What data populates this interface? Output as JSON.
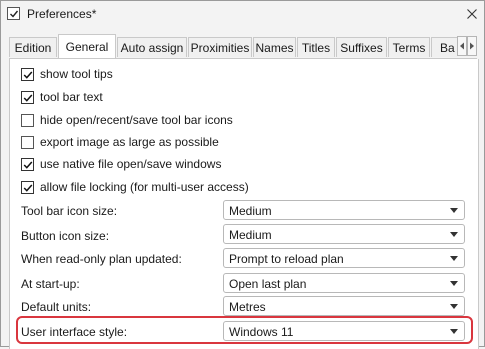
{
  "window": {
    "title": "Preferences*"
  },
  "tabs": [
    {
      "label": "Edition"
    },
    {
      "label": "General"
    },
    {
      "label": "Auto assign"
    },
    {
      "label": "Proximities"
    },
    {
      "label": "Names"
    },
    {
      "label": "Titles"
    },
    {
      "label": "Suffixes"
    },
    {
      "label": "Terms"
    },
    {
      "label": "Ba"
    }
  ],
  "active_tab": "General",
  "checkboxes": [
    {
      "label": "show tool tips",
      "checked": true
    },
    {
      "label": "tool bar text",
      "checked": true
    },
    {
      "label": "hide open/recent/save tool bar icons",
      "checked": false
    },
    {
      "label": "export image as large as possible",
      "checked": false
    },
    {
      "label": "use native file open/save windows",
      "checked": true
    },
    {
      "label": "allow file locking (for multi-user access)",
      "checked": true
    }
  ],
  "settings": [
    {
      "label": "Tool bar icon size:",
      "value": "Medium"
    },
    {
      "label": "Button icon size:",
      "value": "Medium"
    },
    {
      "label": "When read-only plan updated:",
      "value": "Prompt to reload plan"
    },
    {
      "label": "At start-up:",
      "value": "Open last plan"
    },
    {
      "label": "Default units:",
      "value": "Metres"
    },
    {
      "label": "User interface style:",
      "value": "Windows 11"
    }
  ],
  "icons": {
    "app": "checkbox-app-icon",
    "close": "close-icon",
    "scroll_left": "chevron-left-icon",
    "scroll_right": "chevron-right-icon",
    "dropdown": "chevron-down-icon"
  },
  "colors": {
    "highlight": "#d9363e",
    "panel": "#ffffff",
    "window": "#f3f3f3"
  }
}
